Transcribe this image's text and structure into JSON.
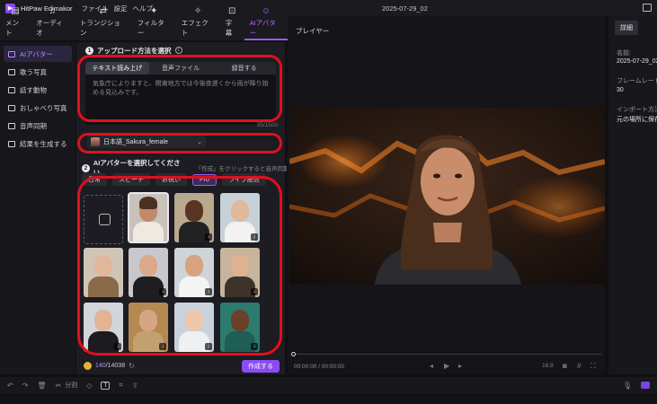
{
  "app": {
    "title": "HitPaw Edimakor",
    "menus": [
      "ファイル",
      "設定",
      "ヘルプ"
    ],
    "project": "2025-07-29_02"
  },
  "toolbar": [
    {
      "label": "メント",
      "icon": "media-icon"
    },
    {
      "label": "オーディオ",
      "icon": "audio-icon"
    },
    {
      "label": "トランジション",
      "icon": "transition-icon"
    },
    {
      "label": "フィルター",
      "icon": "filter-icon"
    },
    {
      "label": "エフェクト",
      "icon": "effect-icon"
    },
    {
      "label": "字幕",
      "icon": "subtitle-icon"
    },
    {
      "label": "AIアバター",
      "icon": "ai-avatar-icon",
      "active": true
    }
  ],
  "sidebar": [
    {
      "label": "AIアバター",
      "active": true
    },
    {
      "label": "歌う写真"
    },
    {
      "label": "話す動物"
    },
    {
      "label": "おしゃべり写真"
    },
    {
      "label": "音声同期"
    },
    {
      "label": "結果を生成する"
    }
  ],
  "section1": {
    "number": "1",
    "title": "アップロード方法を選択",
    "tabs": [
      "テキスト読み上げ",
      "音声ファイル",
      "録音する"
    ],
    "text": "気象庁によりますと、関東地方では今後夜遅くから雨が降り始める見込みです。",
    "counter": "35/1500",
    "voice": "日本語_Sakura_female"
  },
  "section2": {
    "number": "2",
    "title": "AIアバターを選択してください",
    "hint": "「作成」をクリックすると音声同期",
    "filters": [
      "日常",
      "スピーチ",
      "お祝い",
      "Pro",
      "ライブ配信"
    ],
    "active_filter": "Pro"
  },
  "credits": {
    "used": "140",
    "total": "/14038"
  },
  "create_button": "作成する",
  "player": {
    "title": "プレイヤー",
    "time": "00:00:00 / 00:00:00",
    "ratio": "16:9"
  },
  "details": {
    "tab": "詳細",
    "name_label": "名前:",
    "name_value": "2025-07-29_02",
    "framerate_label": "フレームレート",
    "framerate_value": "30",
    "import_label": "インポート方法",
    "import_value": "元の場所に保存"
  },
  "timeline": {
    "split_label": "分割"
  }
}
